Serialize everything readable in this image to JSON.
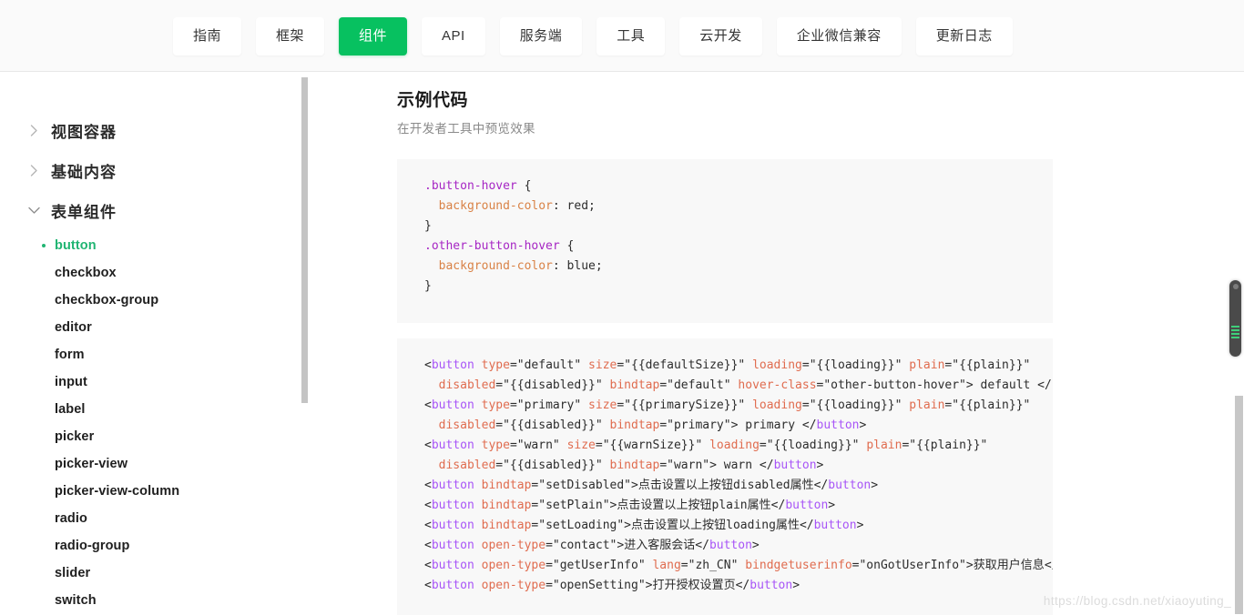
{
  "topnav": {
    "tabs": [
      {
        "label": "指南",
        "active": false
      },
      {
        "label": "框架",
        "active": false
      },
      {
        "label": "组件",
        "active": true
      },
      {
        "label": "API",
        "active": false
      },
      {
        "label": "服务端",
        "active": false
      },
      {
        "label": "工具",
        "active": false
      },
      {
        "label": "云开发",
        "active": false
      },
      {
        "label": "企业微信兼容",
        "active": false
      },
      {
        "label": "更新日志",
        "active": false
      }
    ],
    "active_color": "#07c160"
  },
  "sidebar": {
    "groups": [
      {
        "label": "视图容器",
        "expanded": false,
        "icon": "chevron-right-icon",
        "children": []
      },
      {
        "label": "基础内容",
        "expanded": false,
        "icon": "chevron-right-icon",
        "children": []
      },
      {
        "label": "表单组件",
        "expanded": true,
        "icon": "chevron-down-icon",
        "children": [
          {
            "label": "button",
            "active": true
          },
          {
            "label": "checkbox",
            "active": false
          },
          {
            "label": "checkbox-group",
            "active": false
          },
          {
            "label": "editor",
            "active": false
          },
          {
            "label": "form",
            "active": false
          },
          {
            "label": "input",
            "active": false
          },
          {
            "label": "label",
            "active": false
          },
          {
            "label": "picker",
            "active": false
          },
          {
            "label": "picker-view",
            "active": false
          },
          {
            "label": "picker-view-column",
            "active": false
          },
          {
            "label": "radio",
            "active": false
          },
          {
            "label": "radio-group",
            "active": false
          },
          {
            "label": "slider",
            "active": false
          },
          {
            "label": "switch",
            "active": false
          }
        ]
      }
    ],
    "active_item_color": "#21b573"
  },
  "main": {
    "title": "示例代码",
    "subtitle": "在开发者工具中预览效果",
    "css_code": [
      ".button-hover {",
      "  background-color: red;",
      "}",
      ".other-button-hover {",
      "  background-color: blue;",
      "}"
    ],
    "html_code": [
      "<button type=\"default\" size=\"{{defaultSize}}\" loading=\"{{loading}}\" plain=\"{{plain}}\"",
      "  disabled=\"{{disabled}}\" bindtap=\"default\" hover-class=\"other-button-hover\"> default </button>",
      "<button type=\"primary\" size=\"{{primarySize}}\" loading=\"{{loading}}\" plain=\"{{plain}}\"",
      "  disabled=\"{{disabled}}\" bindtap=\"primary\"> primary </button>",
      "<button type=\"warn\" size=\"{{warnSize}}\" loading=\"{{loading}}\" plain=\"{{plain}}\"",
      "  disabled=\"{{disabled}}\" bindtap=\"warn\"> warn </button>",
      "<button bindtap=\"setDisabled\">点击设置以上按钮disabled属性</button>",
      "<button bindtap=\"setPlain\">点击设置以上按钮plain属性</button>",
      "<button bindtap=\"setLoading\">点击设置以上按钮loading属性</button>",
      "<button open-type=\"contact\">进入客服会话</button>",
      "<button open-type=\"getUserInfo\" lang=\"zh_CN\" bindgetuserinfo=\"onGotUserInfo\">获取用户信息</button>",
      "<button open-type=\"openSetting\">打开授权设置页</button>"
    ]
  },
  "watermark": {
    "text": "https://blog.csdn.net/xiaoyuting_"
  }
}
